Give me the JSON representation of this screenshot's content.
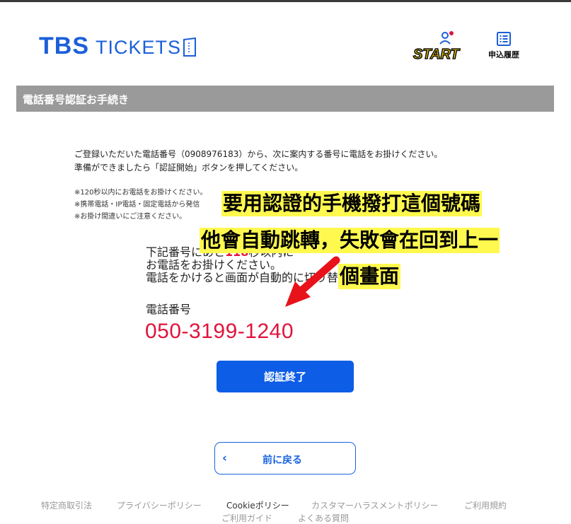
{
  "header": {
    "logo_main": "TBS",
    "logo_sub": "TICKETS",
    "start_label": "START",
    "history_label": "申込履歴"
  },
  "section": {
    "title": "電話番号認証お手続き"
  },
  "intro": {
    "line1": "ご登録いただいた電話番号（0908976183）から、次に案内する番号に電話をお掛けください。",
    "line2": "準備ができましたら「認証開始」ボタンを押してください。"
  },
  "notes": {
    "n1": "※120秒以内にお電話をお掛けください。",
    "n2": "※携帯電話・IP電話・固定電話から発信",
    "n3": "※お掛け間違いにご注意ください。"
  },
  "dial": {
    "line1_pre": "下記番号にあと",
    "line1_count": "118",
    "line1_post": "秒以内に",
    "line2": "お電話をお掛けください。",
    "line3": "電話をかけると画面が自動的に切り替わります。",
    "phone_label": "電話番号",
    "phone_number": "050-3199-1240"
  },
  "buttons": {
    "end_auth": "認証終了",
    "back": "前に戻る",
    "back_chevron": "‹"
  },
  "footer": {
    "l1": "特定商取引法",
    "l2": "プライバシーポリシー",
    "l3": "Cookieポリシー",
    "l4": "カスタマーハラスメントポリシー",
    "l5": "ご利用規約",
    "l6": "ご利用ガイド",
    "l7": "よくある質問"
  },
  "annotation": {
    "line1": "要用認證的手機撥打這個號碼",
    "line2": "他會自動跳轉，失敗會在回到上一",
    "line3": "個畫面",
    "color": "#fff94f",
    "arrow_color": "#e8121a"
  },
  "colors": {
    "brand_blue": "#1b5fd9",
    "button_blue": "#0d5de6",
    "accent_red": "#e0143c",
    "section_gray": "#9a9a9a"
  }
}
